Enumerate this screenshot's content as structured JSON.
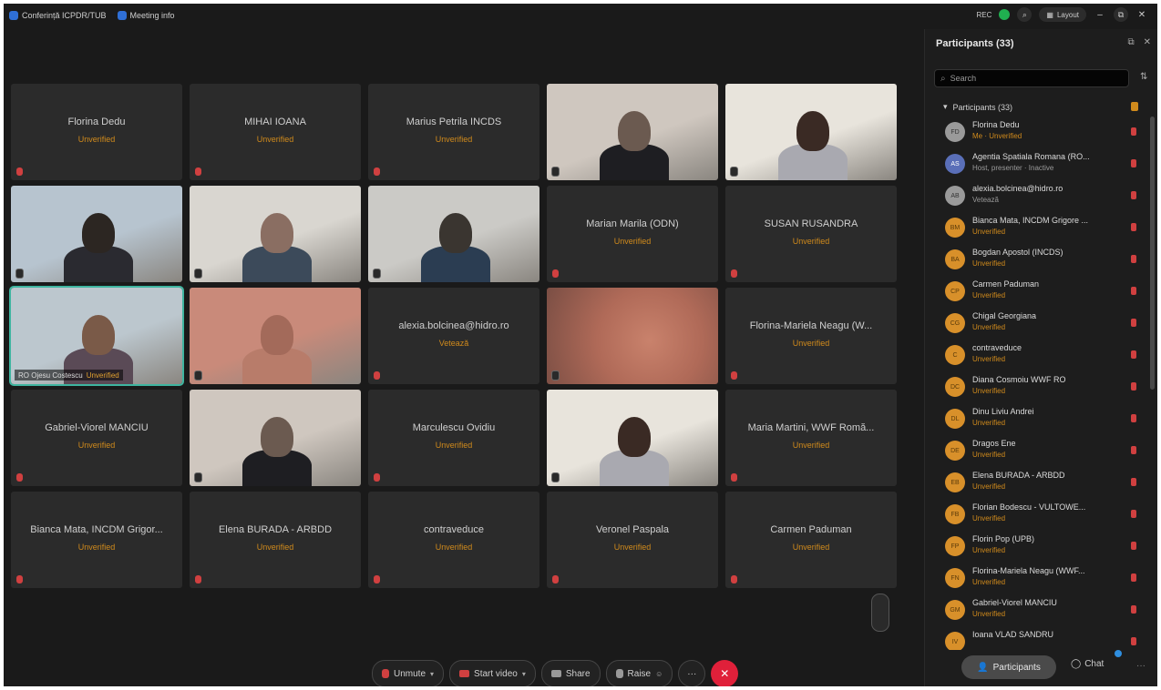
{
  "topbar": {
    "app_label": "Conferință ICPDR/TUB",
    "meeting_info": "Meeting info",
    "rec": "REC",
    "layout": "Layout"
  },
  "tiles": [
    {
      "name": "Florina Dedu",
      "status": "Unverified",
      "video": false
    },
    {
      "name": "MIHAI IOANA",
      "status": "Unverified",
      "video": false
    },
    {
      "name": "Marius Petrila INCDS",
      "status": "Unverified",
      "video": false
    },
    {
      "name": "",
      "status": "",
      "video": true
    },
    {
      "name": "",
      "status": "",
      "video": true
    },
    {
      "name": "",
      "status": "",
      "video": true
    },
    {
      "name": "",
      "status": "",
      "video": true
    },
    {
      "name": "",
      "status": "",
      "video": true
    },
    {
      "name": "Marian Marila (ODN)",
      "status": "Unverified",
      "video": false
    },
    {
      "name": "SUSAN RUSANDRA",
      "status": "Unverified",
      "video": false
    },
    {
      "name": "",
      "status": "",
      "video": true,
      "active": true,
      "label": "RO Ojesu Costescu",
      "label_status": "Unverified"
    },
    {
      "name": "",
      "status": "",
      "video": true
    },
    {
      "name": "alexia.bolcinea@hidro.ro",
      "status": "Vetează",
      "video": false
    },
    {
      "name": "",
      "status": "",
      "video": true
    },
    {
      "name": "Florina-Mariela Neagu (W...",
      "status": "Unverified",
      "video": false
    },
    {
      "name": "Gabriel-Viorel MANCIU",
      "status": "Unverified",
      "video": false
    },
    {
      "name": "",
      "status": "",
      "video": true
    },
    {
      "name": "Marculescu Ovidiu",
      "status": "Unverified",
      "video": false
    },
    {
      "name": "",
      "status": "",
      "video": true
    },
    {
      "name": "Maria Martini, WWF Romă...",
      "status": "Unverified",
      "video": false
    },
    {
      "name": "Bianca Mata, INCDM Grigor...",
      "status": "Unverified",
      "video": false
    },
    {
      "name": "Elena BURADA - ARBDD",
      "status": "Unverified",
      "video": false
    },
    {
      "name": "contraveduce",
      "status": "Unverified",
      "video": false
    },
    {
      "name": "Veronel Paspala",
      "status": "Unverified",
      "video": false
    },
    {
      "name": "Carmen Paduman",
      "status": "Unverified",
      "video": false
    }
  ],
  "toolbar": {
    "unmute": "Unmute",
    "start_video": "Start video",
    "share": "Share",
    "raise": "Raise",
    "more": "···"
  },
  "panel": {
    "title": "Participants (33)",
    "search_placeholder": "Search",
    "section": "Participants (33)",
    "participants": [
      {
        "name": "Florina Dedu",
        "status": "Me · Unverified",
        "avatar": "grey",
        "initials": "FD"
      },
      {
        "name": "Agentia Spatiala Romana (RO...",
        "status": "Host, presenter · Inactive",
        "avatar": "blue",
        "initials": "AS",
        "grey": true
      },
      {
        "name": "alexia.bolcinea@hidro.ro",
        "status": "Vetează",
        "avatar": "grey",
        "initials": "AB",
        "grey": true
      },
      {
        "name": "Bianca Mata, INCDM Grigore ...",
        "status": "Unverified",
        "avatar": "orange",
        "initials": "BM"
      },
      {
        "name": "Bogdan Apostol (INCDS)",
        "status": "Unverified",
        "avatar": "orange",
        "initials": "BA"
      },
      {
        "name": "Carmen Paduman",
        "status": "Unverified",
        "avatar": "orange",
        "initials": "CP"
      },
      {
        "name": "Chigal Georgiana",
        "status": "Unverified",
        "avatar": "orange",
        "initials": "CG"
      },
      {
        "name": "contraveduce",
        "status": "Unverified",
        "avatar": "orange",
        "initials": "C"
      },
      {
        "name": "Diana Cosmoiu WWF RO",
        "status": "Unverified",
        "avatar": "orange",
        "initials": "DC"
      },
      {
        "name": "Dinu Liviu Andrei",
        "status": "Unverified",
        "avatar": "orange",
        "initials": "DL"
      },
      {
        "name": "Dragos Ene",
        "status": "Unverified",
        "avatar": "orange",
        "initials": "DE"
      },
      {
        "name": "Elena BURADA - ARBDD",
        "status": "Unverified",
        "avatar": "orange",
        "initials": "EB"
      },
      {
        "name": "Florian Bodescu - VULTOWE...",
        "status": "Unverified",
        "avatar": "orange",
        "initials": "FB"
      },
      {
        "name": "Florin Pop (UPB)",
        "status": "Unverified",
        "avatar": "orange",
        "initials": "FP"
      },
      {
        "name": "Florina-Mariela Neagu (WWF...",
        "status": "Unverified",
        "avatar": "orange",
        "initials": "FN"
      },
      {
        "name": "Gabriel-Viorel MANCIU",
        "status": "Unverified",
        "avatar": "orange",
        "initials": "GM"
      },
      {
        "name": "Ioana VLAD SANDRU",
        "status": "",
        "avatar": "orange",
        "initials": "IV"
      }
    ],
    "participants_button": "Participants",
    "chat_button": "Chat"
  }
}
